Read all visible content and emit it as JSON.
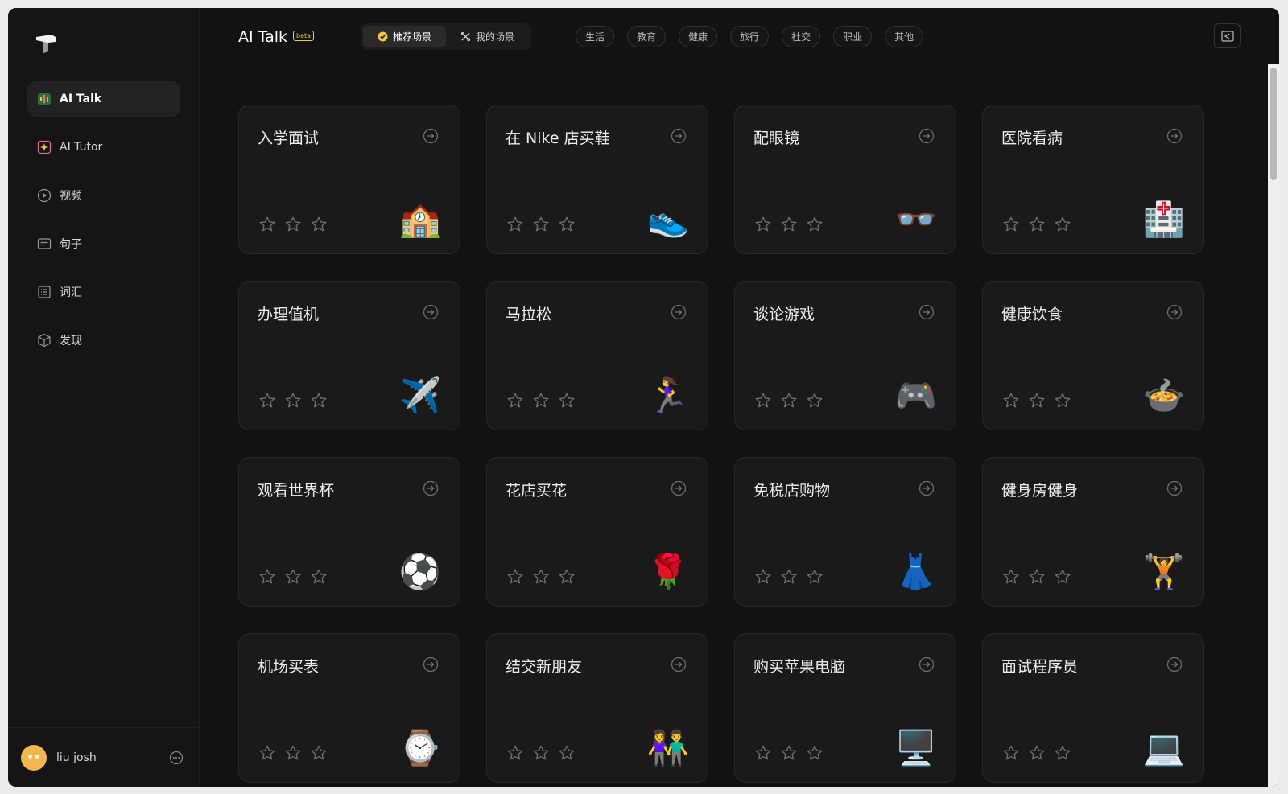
{
  "app": {
    "title": "AI Talk",
    "badge": "beta"
  },
  "sidebar": {
    "items": [
      {
        "label": "AI Talk",
        "icon": "waveform-icon",
        "active": true
      },
      {
        "label": "AI Tutor",
        "icon": "sparkle-icon"
      },
      {
        "label": "视频",
        "icon": "play-circle-icon"
      },
      {
        "label": "句子",
        "icon": "sentence-icon"
      },
      {
        "label": "词汇",
        "icon": "list-icon"
      },
      {
        "label": "发现",
        "icon": "cube-icon"
      }
    ],
    "user": {
      "name": "liu josh"
    }
  },
  "tabs": [
    {
      "label": "推荐场景",
      "icon": "verified-badge-icon",
      "active": true
    },
    {
      "label": "我的场景",
      "icon": "dice-icon"
    }
  ],
  "categories": [
    "生活",
    "教育",
    "健康",
    "旅行",
    "社交",
    "职业",
    "其他"
  ],
  "scenes": [
    {
      "title": "入学面试",
      "emoji": "🏫"
    },
    {
      "title": "在 Nike 店买鞋",
      "emoji": "👟"
    },
    {
      "title": "配眼镜",
      "emoji": "👓"
    },
    {
      "title": "医院看病",
      "emoji": "🏥"
    },
    {
      "title": "办理值机",
      "emoji": "✈️"
    },
    {
      "title": "马拉松",
      "emoji": "🏃‍♀️"
    },
    {
      "title": "谈论游戏",
      "emoji": "🎮"
    },
    {
      "title": "健康饮食",
      "emoji": "🍲"
    },
    {
      "title": "观看世界杯",
      "emoji": "⚽"
    },
    {
      "title": "花店买花",
      "emoji": "🌹"
    },
    {
      "title": "免税店购物",
      "emoji": "👗"
    },
    {
      "title": "健身房健身",
      "emoji": "🏋️"
    },
    {
      "title": "机场买表",
      "emoji": "⌚"
    },
    {
      "title": "结交新朋友",
      "emoji": "👫"
    },
    {
      "title": "购买苹果电脑",
      "emoji": "🖥️"
    },
    {
      "title": "面试程序员",
      "emoji": "💻"
    }
  ],
  "colors": {
    "accent": "#f3c34a",
    "background": "#121212",
    "card": "#1a1a1a"
  }
}
